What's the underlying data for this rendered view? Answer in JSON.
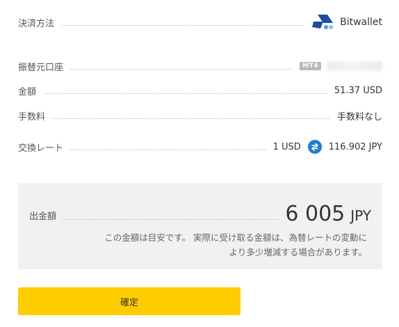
{
  "payment_method": {
    "label": "決済方法",
    "value": "Bitwallet",
    "icon": "bitwallet-logo-icon",
    "brand_color": "#1c4fa1"
  },
  "transfer_account": {
    "label": "振替元口座",
    "badge": "MT4",
    "account_number_visible": false
  },
  "amount": {
    "label": "金額",
    "value": "51.37 USD"
  },
  "fee": {
    "label": "手数料",
    "value": "手数料なし"
  },
  "exchange_rate": {
    "label": "交換レート",
    "from": "1 USD",
    "icon": "swap-arrows-icon",
    "to": "116.902 JPY",
    "icon_color": "#1e7fd0"
  },
  "withdrawal": {
    "label": "出金額",
    "amount": "6 005",
    "currency": "JPY",
    "note_line1": "この金額は目安です。 実際に受け取る金額は、為替レートの変動に",
    "note_line2": "より多少増減する場合があります。"
  },
  "confirm_button": {
    "label": "確定",
    "color": "#ffcc00"
  }
}
